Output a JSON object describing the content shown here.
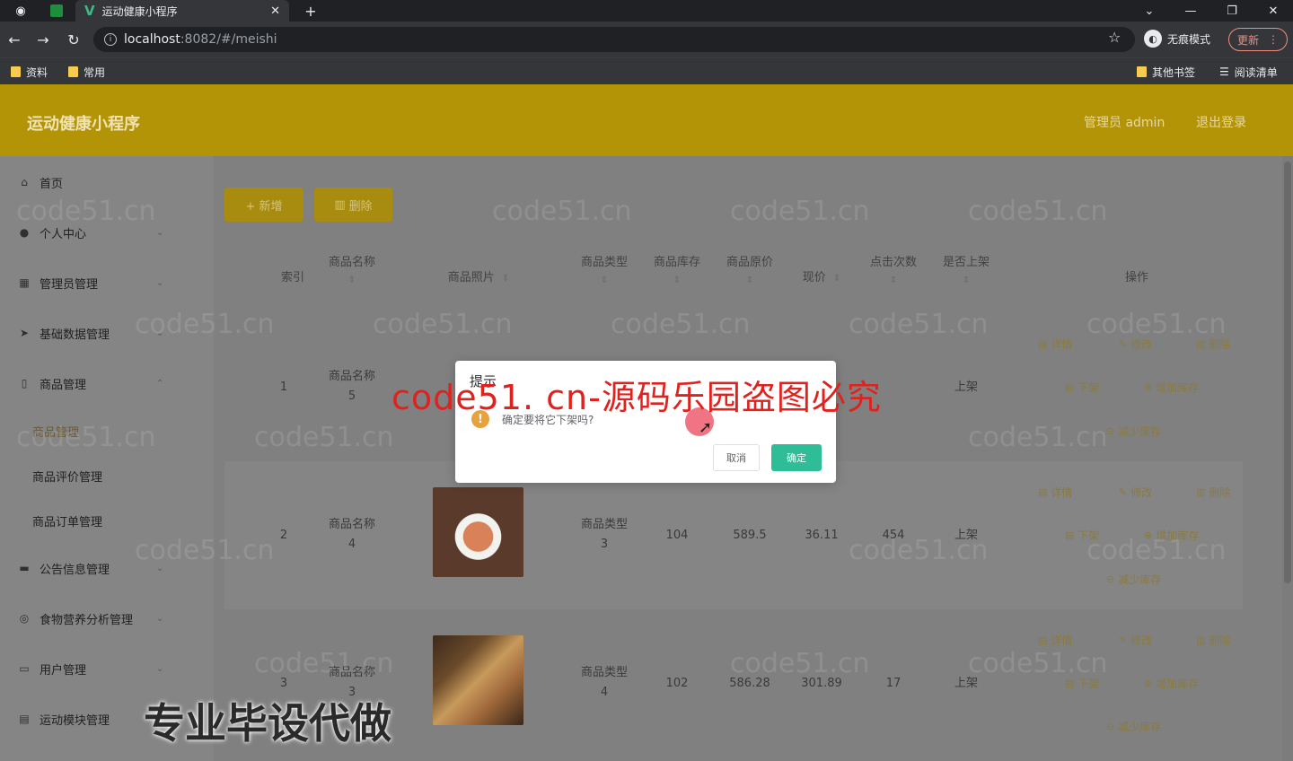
{
  "browser": {
    "tab_title": "运动健康小程序",
    "url_host": "localhost",
    "url_rest": ":8082/#/meishi",
    "incognito_label": "无痕模式",
    "update_label": "更新",
    "bookmarks": [
      "资料",
      "常用"
    ],
    "bookmarks_right": [
      "其他书签",
      "阅读清单"
    ]
  },
  "header": {
    "app_title": "运动健康小程序",
    "admin_label": "管理员 admin",
    "logout_label": "退出登录"
  },
  "sidebar": {
    "items": [
      {
        "label": "首页",
        "icon": "home-icon"
      },
      {
        "label": "个人中心",
        "icon": "user-icon"
      },
      {
        "label": "管理员管理",
        "icon": "grid-icon"
      },
      {
        "label": "基础数据管理",
        "icon": "send-icon"
      },
      {
        "label": "商品管理",
        "icon": "phone-icon"
      },
      {
        "label": "公告信息管理",
        "icon": "briefcase-icon"
      },
      {
        "label": "食物营养分析管理",
        "icon": "compass-icon"
      },
      {
        "label": "用户管理",
        "icon": "card-icon"
      },
      {
        "label": "运动模块管理",
        "icon": "table-icon"
      }
    ],
    "subitems": [
      "商品管理",
      "商品评价管理",
      "商品订单管理"
    ]
  },
  "toolbar": {
    "add_label": "+ 新增",
    "delete_label": "删除"
  },
  "table": {
    "headers": {
      "index": "索引",
      "name": "商品名称",
      "photo": "商品照片",
      "type": "商品类型",
      "stock": "商品库存",
      "orig_price": "商品原价",
      "price": "现价",
      "clicks": "点击次数",
      "on_shelf": "是否上架",
      "actions": "操作"
    },
    "rows": [
      {
        "index": "1",
        "name_a": "商品名称",
        "name_b": "5",
        "type_a": "",
        "type_b": "",
        "stock": "",
        "orig_price": "",
        "price": "",
        "clicks": "",
        "on_shelf": "上架"
      },
      {
        "index": "2",
        "name_a": "商品名称",
        "name_b": "4",
        "type_a": "商品类型",
        "type_b": "3",
        "stock": "104",
        "orig_price": "589.5",
        "price": "36.11",
        "clicks": "454",
        "on_shelf": "上架"
      },
      {
        "index": "3",
        "name_a": "商品名称",
        "name_b": "3",
        "type_a": "商品类型",
        "type_b": "4",
        "stock": "102",
        "orig_price": "586.28",
        "price": "301.89",
        "clicks": "17",
        "on_shelf": "上架"
      }
    ],
    "actions": {
      "detail": "详情",
      "edit": "修改",
      "delete": "删除",
      "off_shelf": "下架",
      "add_stock": "增加库存",
      "reduce_stock": "减少库存"
    }
  },
  "dialog": {
    "title": "提示",
    "message": "确定要将它下架吗?",
    "cancel": "取消",
    "confirm": "确定"
  },
  "watermarks": {
    "site": "code51.cn",
    "red": "code51. cn-源码乐园盗图必究",
    "bottom": "专业毕设代做"
  }
}
